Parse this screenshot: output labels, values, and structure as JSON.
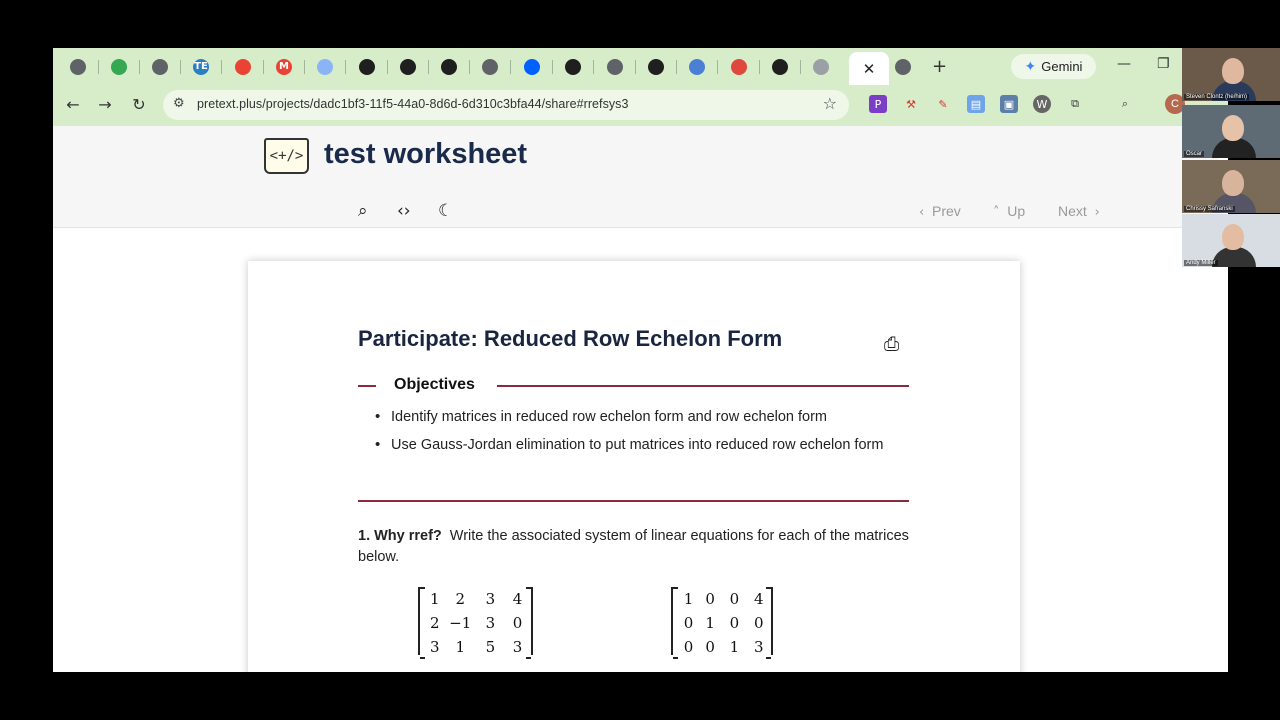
{
  "browser": {
    "tabs": [
      {
        "icon": "globe-icon",
        "color": "#5f6368"
      },
      {
        "icon": "google-drive-icon",
        "color": "#34a853"
      },
      {
        "icon": "globe-icon",
        "color": "#5f6368"
      },
      {
        "icon": "te-icon",
        "color": "#2a7fc4",
        "text": "TE"
      },
      {
        "icon": "color-wheel-icon",
        "color": "#ea4335"
      },
      {
        "icon": "gmail-icon",
        "color": "#ea4335",
        "text": "M"
      },
      {
        "icon": "circle-app-icon",
        "color": "#8ab4f8"
      },
      {
        "icon": "github-icon",
        "color": "#1f1f1f"
      },
      {
        "icon": "github-icon",
        "color": "#1f1f1f"
      },
      {
        "icon": "github-icon",
        "color": "#1f1f1f"
      },
      {
        "icon": "globe-icon",
        "color": "#5f6368"
      },
      {
        "icon": "dropbox-icon",
        "color": "#0061fe"
      },
      {
        "icon": "github-icon",
        "color": "#1f1f1f"
      },
      {
        "icon": "star-logo-icon",
        "color": "#5f6368"
      },
      {
        "icon": "github-icon",
        "color": "#1f1f1f"
      },
      {
        "icon": "people-icon",
        "color": "#4a7fd4"
      },
      {
        "icon": "chrome-app-icon",
        "color": "#e0483e"
      },
      {
        "icon": "github-icon",
        "color": "#1f1f1f"
      },
      {
        "icon": "mail-icon",
        "color": "#9aa0a6"
      },
      {
        "icon": "globe-icon",
        "color": "#5f6368"
      }
    ],
    "gemini_label": "Gemini",
    "url": "pretext.plus/projects/dadc1bf3-11f5-44a0-8d6d-6d310c3bfa44/share#rrefsys3",
    "profile_initial": "C",
    "accent": "#d7ecc9"
  },
  "page": {
    "site_title": "test worksheet",
    "logo_text": "<+/>",
    "nav": {
      "prev": "Prev",
      "up": "Up",
      "next": "Next"
    },
    "section_title": "Participate: Reduced Row Echelon Form",
    "objectives_heading": "Objectives",
    "objectives": [
      "Identify matrices in reduced row echelon form and row echelon form",
      "Use Gauss-Jordan elimination to put matrices into reduced row echelon form"
    ],
    "task": {
      "number": "1. Why rref?",
      "text": "Write the associated system of linear equations for each of the matrices below."
    },
    "matrices": [
      [
        [
          "1",
          "2",
          "3",
          "4"
        ],
        [
          "2",
          "−1",
          "3",
          "0"
        ],
        [
          "3",
          "1",
          "5",
          "3"
        ]
      ],
      [
        [
          "1",
          "0",
          "0",
          "4"
        ],
        [
          "0",
          "1",
          "0",
          "0"
        ],
        [
          "0",
          "0",
          "1",
          "3"
        ]
      ]
    ],
    "rule_color": "#8a2a3c"
  },
  "participants": [
    {
      "name": "Steven Clontz (he/him)"
    },
    {
      "name": "Oscar"
    },
    {
      "name": "Chrissy Safranski"
    },
    {
      "name": "Andy Miller"
    }
  ]
}
